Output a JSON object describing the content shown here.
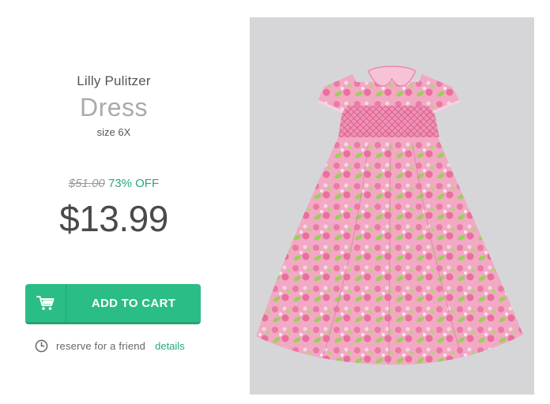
{
  "product": {
    "brand": "Lilly Pulitzer",
    "type": "Dress",
    "size": "size 6X",
    "original_price": "$51.00",
    "discount": "73% OFF",
    "price": "$13.99"
  },
  "actions": {
    "add_to_cart_label": "ADD TO CART",
    "reserve_label": "reserve for a friend",
    "details_label": "details"
  },
  "colors": {
    "accent": "#2bbd86",
    "discount_text": "#2aa876",
    "price_text": "#4a4a4a"
  },
  "icons": {
    "cart": "cart-icon",
    "reserve": "clock-icon"
  }
}
